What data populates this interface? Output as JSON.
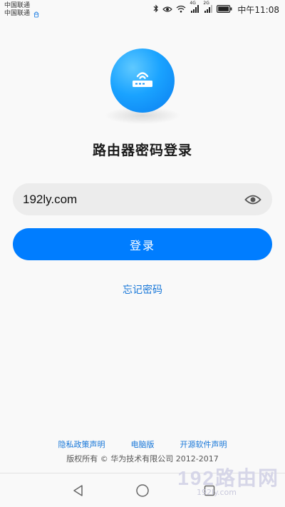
{
  "status_bar": {
    "carrier_1": "中国联通",
    "carrier_2": "中国联通",
    "network_1": "4G",
    "network_2": "2G",
    "time": "中午11:08"
  },
  "page": {
    "title": "路由器密码登录",
    "logo_icon": "router-icon"
  },
  "password_field": {
    "value": "192ly.com",
    "toggle_icon": "eye-icon"
  },
  "login_button": {
    "label": "登录"
  },
  "forgot_password": {
    "label": "忘记密码"
  },
  "footer": {
    "links": [
      "隐私政策声明",
      "电脑版",
      "开源软件声明"
    ],
    "copyright": "版权所有 © 华为技术有限公司 2012-2017"
  },
  "watermark": {
    "text": "192路由网",
    "sub": "192ly.com"
  },
  "colors": {
    "primary": "#007dff",
    "link": "#1676d8",
    "background": "#f9f9f9",
    "field_bg": "#ececec"
  }
}
